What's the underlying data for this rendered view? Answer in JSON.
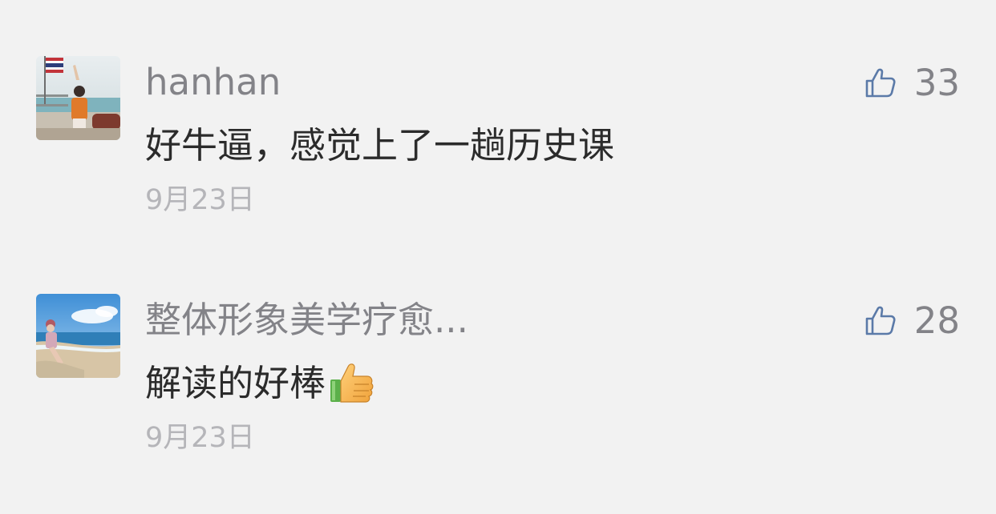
{
  "comments": [
    {
      "username": "hanhan",
      "text": "好牛逼，感觉上了一趟历史课",
      "date": "9月23日",
      "likes": "33",
      "avatar_icon": "avatar-woman-on-boat-with-flag",
      "like_icon": "thumbs-up-outline-icon"
    },
    {
      "username": "整体形象美学疗愈...",
      "text": "解读的好棒",
      "emoji": "thumbs-up-emoji",
      "date": "9月23日",
      "likes": "28",
      "avatar_icon": "avatar-woman-on-beach",
      "like_icon": "thumbs-up-outline-icon"
    }
  ],
  "colors": {
    "background": "#f2f2f2",
    "username": "#838388",
    "text": "#2b2b2b",
    "timestamp": "#b5b5b9",
    "like_icon": "#5b7aa8"
  }
}
